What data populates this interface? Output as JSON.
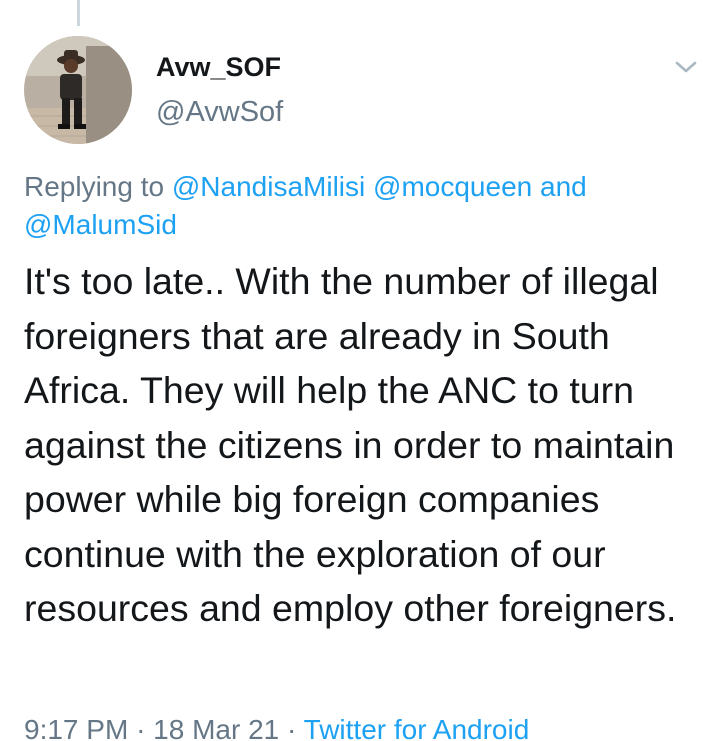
{
  "author": {
    "display_name": "Avw_SOF",
    "handle": "@AvwSof",
    "avatar_icon": "user-photo-avatar"
  },
  "reply_context": {
    "prefix": "Replying to",
    "mentions": [
      "@NandisaMilisi",
      "@mocqueen"
    ],
    "conjunction": "and",
    "last_mention": "@MalumSid"
  },
  "tweet": {
    "text": "It's too late.. With the number of illegal foreigners that are already in South Africa. They will help the ANC to turn against the citizens in order to maintain power while big foreign companies continue with the exploration of our resources and employ other foreigners."
  },
  "meta": {
    "time": "9:17 PM",
    "separator": "·",
    "date": "18 Mar 21",
    "source": "Twitter for Android"
  },
  "icons": {
    "more": "chevron-down-icon"
  },
  "colors": {
    "link": "#1da1f2",
    "secondary_text": "#657786",
    "primary_text": "#14171a",
    "thread_line": "#ccd6dd"
  }
}
